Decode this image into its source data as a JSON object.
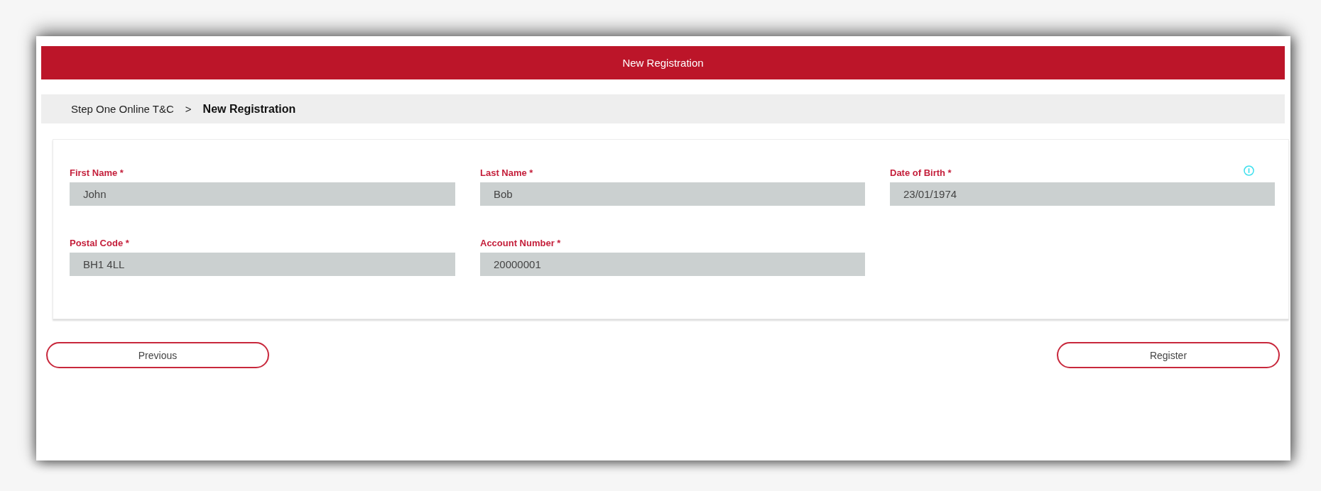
{
  "header": {
    "title": "New Registration"
  },
  "breadcrumb": {
    "separator": ">",
    "items": [
      {
        "label": "Step One Online T&C",
        "current": false
      },
      {
        "label": "New Registration",
        "current": true
      }
    ]
  },
  "form": {
    "fields": [
      {
        "label": "First Name *",
        "value": "John",
        "info": false
      },
      {
        "label": "Last Name *",
        "value": "Bob",
        "info": false
      },
      {
        "label": "Date of Birth *",
        "value": "23/01/1974",
        "info": true
      },
      {
        "label": "Postal Code *",
        "value": "BH1 4LL",
        "info": false
      },
      {
        "label": "Account Number *",
        "value": "20000001",
        "info": false
      }
    ]
  },
  "buttons": [
    {
      "label": "Previous"
    },
    {
      "label": "Register"
    }
  ]
}
